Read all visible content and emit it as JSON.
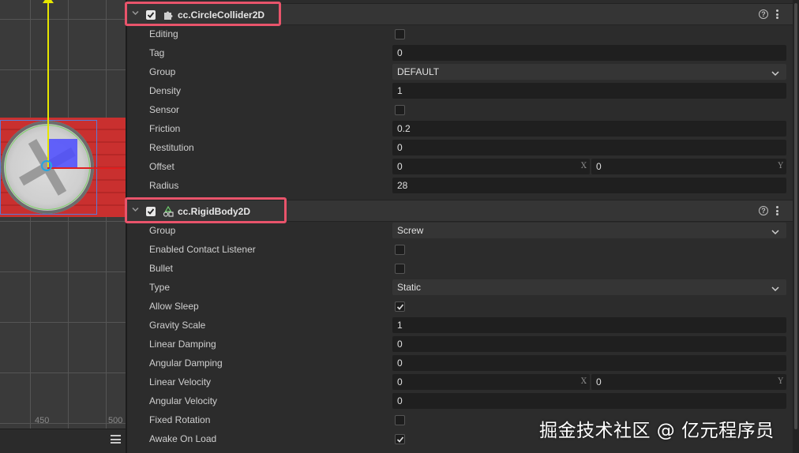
{
  "scene": {
    "ticks": [
      "450",
      "500"
    ]
  },
  "circle_collider": {
    "title": "cc.CircleCollider2D",
    "enabled": true,
    "properties": [
      {
        "label": "Editing",
        "kind": "checkbox",
        "checked": false
      },
      {
        "label": "Tag",
        "kind": "number",
        "value": "0"
      },
      {
        "label": "Group",
        "kind": "select",
        "value": "DEFAULT"
      },
      {
        "label": "Density",
        "kind": "number",
        "value": "1"
      },
      {
        "label": "Sensor",
        "kind": "checkbox",
        "checked": false
      },
      {
        "label": "Friction",
        "kind": "number",
        "value": "0.2"
      },
      {
        "label": "Restitution",
        "kind": "number",
        "value": "0"
      },
      {
        "label": "Offset",
        "kind": "vec2",
        "x": "0",
        "y": "0",
        "x_axis": "X",
        "y_axis": "Y"
      },
      {
        "label": "Radius",
        "kind": "number",
        "value": "28"
      }
    ]
  },
  "rigid_body": {
    "title": "cc.RigidBody2D",
    "enabled": true,
    "properties": [
      {
        "label": "Group",
        "kind": "select",
        "value": "Screw"
      },
      {
        "label": "Enabled Contact Listener",
        "kind": "checkbox",
        "checked": false
      },
      {
        "label": "Bullet",
        "kind": "checkbox",
        "checked": false
      },
      {
        "label": "Type",
        "kind": "select",
        "value": "Static"
      },
      {
        "label": "Allow Sleep",
        "kind": "checkbox",
        "checked": true
      },
      {
        "label": "Gravity Scale",
        "kind": "number",
        "value": "1"
      },
      {
        "label": "Linear Damping",
        "kind": "number",
        "value": "0"
      },
      {
        "label": "Angular Damping",
        "kind": "number",
        "value": "0"
      },
      {
        "label": "Linear Velocity",
        "kind": "vec2",
        "x": "0",
        "y": "0",
        "x_axis": "X",
        "y_axis": "Y"
      },
      {
        "label": "Angular Velocity",
        "kind": "number",
        "value": "0"
      },
      {
        "label": "Fixed Rotation",
        "kind": "checkbox",
        "checked": false
      },
      {
        "label": "Awake On Load",
        "kind": "checkbox",
        "checked": true
      }
    ]
  },
  "watermark": "掘金技术社区 @ 亿元程序员",
  "colors": {
    "highlight": "#e9546b",
    "panel_bg": "#2c2c2c",
    "field_bg": "#1f1f1f",
    "header_bg": "#353535"
  },
  "icons": {
    "collapse": "chevron-down-icon",
    "collider": "puzzle-icon",
    "rigidbody": "shapes-icon",
    "help": "help-circle-icon",
    "more": "more-vertical-icon",
    "dropdown": "chevron-down-icon",
    "menu": "hamburger-menu-icon"
  }
}
